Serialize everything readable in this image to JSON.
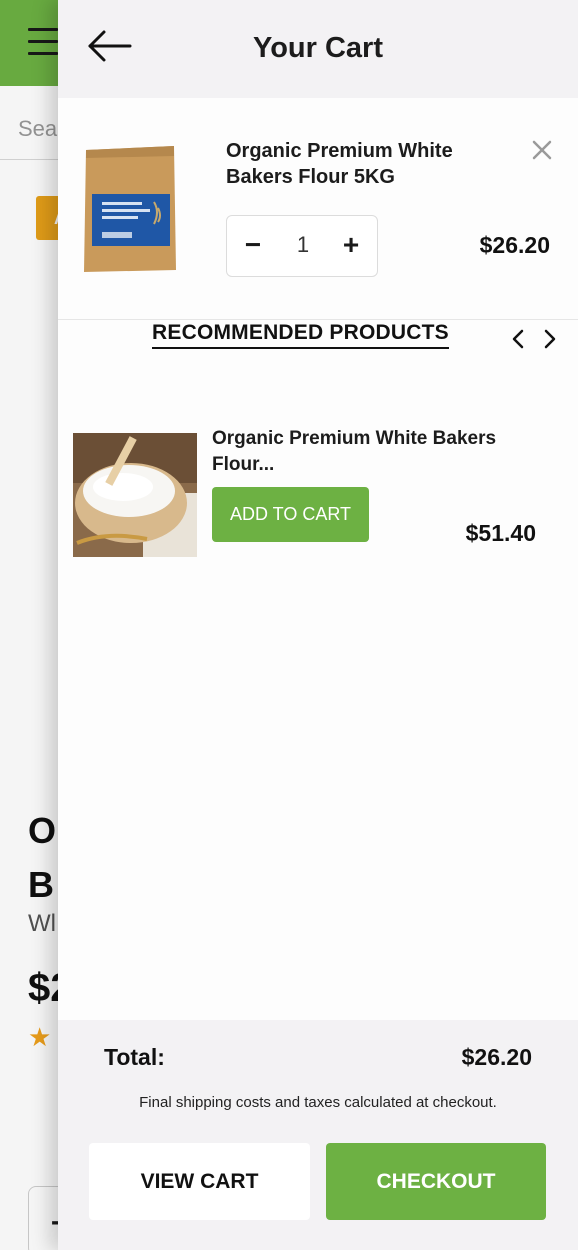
{
  "background": {
    "search_placeholder": "Sea",
    "badge": "A",
    "title_line1": "O",
    "title_line2": "B",
    "subtitle": "Wl",
    "price": "$2",
    "stepper_label": "-"
  },
  "cart": {
    "title": "Your Cart",
    "items": [
      {
        "name": "Organic Premium White Bakers Flour 5KG",
        "quantity": "1",
        "price": "$26.20"
      }
    ]
  },
  "recommended": {
    "heading": "RECOMMENDED PRODUCTS",
    "items": [
      {
        "name": "Organic Premium White Bakers Flour...",
        "button": "ADD TO CART",
        "price": "$51.40"
      }
    ]
  },
  "footer": {
    "total_label": "Total:",
    "total_value": "$26.20",
    "note": "Final shipping costs and taxes calculated at checkout.",
    "view_cart": "VIEW CART",
    "checkout": "CHECKOUT"
  },
  "colors": {
    "brand_green": "#6db143",
    "badge_orange": "#e9a219",
    "panel_grey": "#f3f2f4"
  }
}
